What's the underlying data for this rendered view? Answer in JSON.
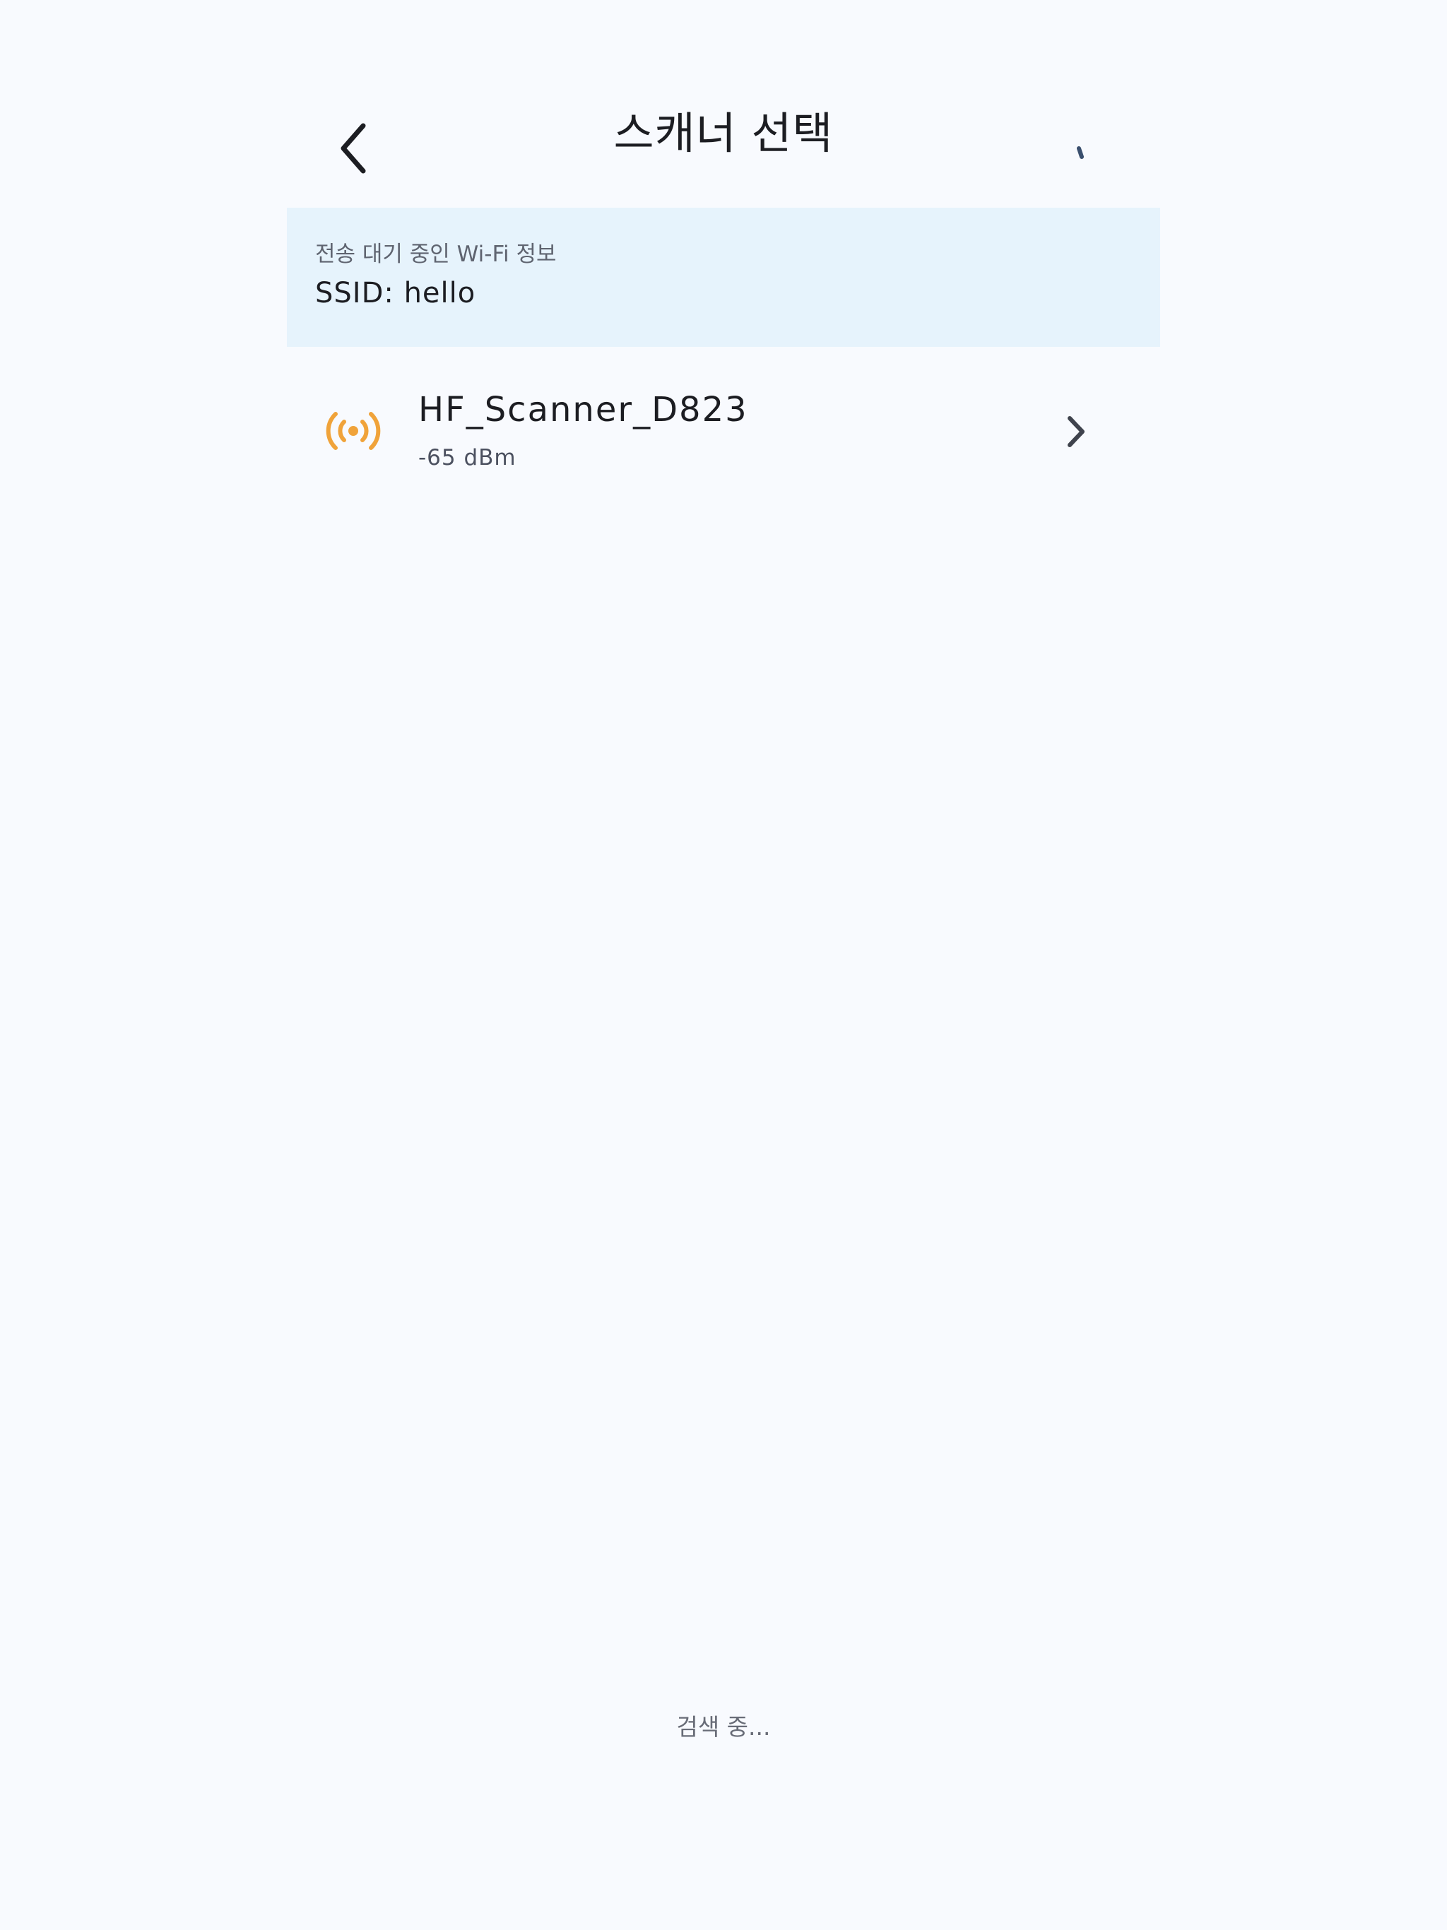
{
  "header": {
    "title": "스캐너 선택",
    "back_icon": "chevron-left-icon",
    "loading_icon": "spinner-icon"
  },
  "wifi_info": {
    "caption": "전송 대기 중인 Wi-Fi 정보",
    "ssid": "SSID: hello"
  },
  "scanners": [
    {
      "name": "HF_Scanner_D823",
      "signal": "-65 dBm",
      "icon": "broadcast-signal-icon",
      "icon_color": "#f0a33a"
    }
  ],
  "status": {
    "text": "검색 중..."
  },
  "colors": {
    "background": "#f8fafe",
    "panel": "#e6f3fc",
    "spinner": "#3a4f6e"
  }
}
